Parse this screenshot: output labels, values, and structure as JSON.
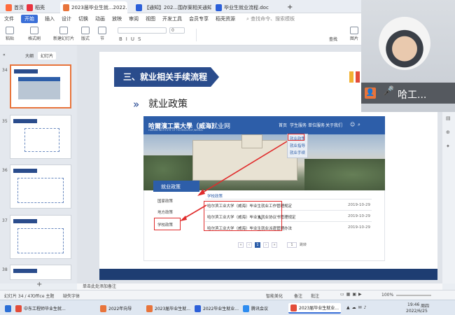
{
  "tabs": [
    {
      "label": "首页",
      "color": "#ff6b3d"
    },
    {
      "label": "稻壳",
      "color": "#e9333f"
    },
    {
      "label": "2023届毕业生就...2022.5.25",
      "color": "#e8743b"
    },
    {
      "label": "【通知】202...围存案相关通知",
      "color": "#2b5fd9"
    },
    {
      "label": "毕业生就业流程.doc",
      "color": "#2b5fd9"
    }
  ],
  "menu": [
    "文件",
    "开始",
    "插入",
    "设计",
    "切换",
    "动画",
    "放映",
    "审阅",
    "视图",
    "开发工具",
    "会员专享",
    "稻壳资源"
  ],
  "search_placeholder": "查找命令、搜索模板",
  "ribbon": {
    "paste": "粘贴",
    "format_painter": "格式刷",
    "new_slide": "新建幻灯片",
    "layout": "版式",
    "section": "节",
    "reset": "重置",
    "font_size": "0",
    "picture": "图片",
    "find": "查找",
    "replace": "替换"
  },
  "left_panel": {
    "tab_outline": "大纲",
    "tab_slides": "幻灯片",
    "thumbs": [
      "34",
      "35",
      "36",
      "37",
      "38"
    ]
  },
  "slide": {
    "section_title": "三、就业相关手续流程",
    "subtitle": "就业政策",
    "site": {
      "logo": "哈爾濱工業大學（威海）",
      "name": "就业网",
      "logo_en": "HARBIN INSTITUTE OF TECHNOLOGY,WEIHAI",
      "nav": [
        "首页",
        "学生服务",
        "单位服务",
        "关于我们"
      ],
      "dropdown": [
        "就业政策",
        "就业指导",
        "就业手续"
      ],
      "policy_box_title": "就业政策",
      "side_items": [
        "国家政策",
        "地方政策",
        "学校政策"
      ],
      "list_head": "学校政策",
      "rows": [
        {
          "title": "哈尔滨工业大学（威海）毕业生就业工作管理规定",
          "date": "2019-10-29"
        },
        {
          "title": "哈尔滨工业大学（威海）毕业生就业协议书管理规定",
          "date": "2019-10-29"
        },
        {
          "title": "哈尔滨工业大学（威海）毕业生就业派遣管理办法",
          "date": "2019-10-29"
        }
      ],
      "pager": [
        "«",
        "‹",
        "1",
        "›",
        "»",
        "1",
        "跳转"
      ]
    }
  },
  "notes_placeholder": "单击此处添加备注",
  "status": {
    "slide_info": "幻灯片 34 / 47",
    "theme": "Office 主题",
    "font_missing": "缺失字体",
    "smart_beautify": "智能美化",
    "notes": "备注",
    "comments": "批注",
    "zoom": "100%"
  },
  "taskbar": {
    "items": [
      "中东工程师毕业生就...",
      "2022年向导",
      "2023届毕业生就...",
      "2022毕业生就业...",
      "腾讯会议",
      "2023届毕业生就业..."
    ],
    "time": "19:46",
    "date": "2022/6/25",
    "weekday": "周四"
  },
  "presenter": {
    "name": "哈工..."
  }
}
